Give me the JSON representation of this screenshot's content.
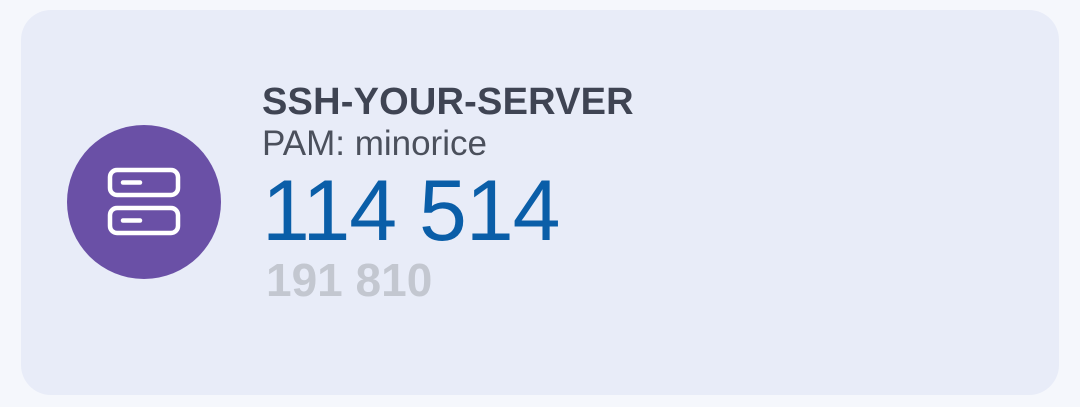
{
  "card": {
    "icon": "server-icon",
    "accent_color": "#6a50a6",
    "title": "SSH-YOUR-SERVER",
    "subtitle": "PAM: minorice",
    "primary_value": "114 514",
    "secondary_value": "191 810",
    "primary_color": "#0a5ea8",
    "secondary_color": "#c3c7d0"
  }
}
